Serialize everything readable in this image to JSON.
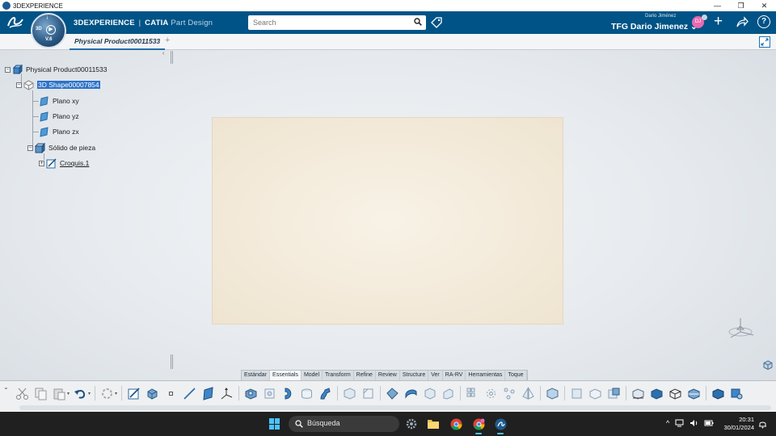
{
  "window": {
    "title": "3DEXPERIENCE",
    "controls": [
      "—",
      "❐",
      "✕"
    ]
  },
  "header": {
    "logo": "3DS",
    "compass": {
      "label_3d": "3D",
      "label_version": "V.6",
      "label_i": "i"
    },
    "brand_bold": "3DEXPERIENCE",
    "brand_sep": "|",
    "brand_product": "CATIA",
    "brand_app": "Part Design",
    "search_placeholder": "Search",
    "user_small": "Dario Jiménez",
    "user_name": "TFG Dario Jimenez ⌄",
    "avatar_initials": "DJ"
  },
  "tabs": {
    "active": "Physical Product00011533",
    "add": "+"
  },
  "tree": {
    "collapse": "‹",
    "nodes": [
      {
        "label": "Physical Product00011533",
        "toggle": "−"
      },
      {
        "label": "3D Shape00007854",
        "toggle": "−"
      },
      {
        "label": "Plano xy"
      },
      {
        "label": "Plano yz"
      },
      {
        "label": "Plano zx"
      },
      {
        "label": "Sólido de pieza",
        "toggle": "−"
      },
      {
        "label": "Croquis.1",
        "toggle": "+"
      }
    ]
  },
  "actionbar": {
    "tabs": [
      "Estándar",
      "Essentials",
      "Model",
      "Transform",
      "Refine",
      "Review",
      "Structure",
      "Ver",
      "RA-RV",
      "Herramientas",
      "Toque"
    ],
    "active_tab": "Essentials",
    "chevron": "⌄"
  },
  "taskbar": {
    "search_label": "Búsqueda",
    "tray_chevron": "^",
    "time": "20:31",
    "date": "30/01/2024"
  },
  "colors": {
    "header_blue": "#005386",
    "selection": "#2c72c7",
    "taskbar": "#202020",
    "accent": "#4cc2ff"
  }
}
